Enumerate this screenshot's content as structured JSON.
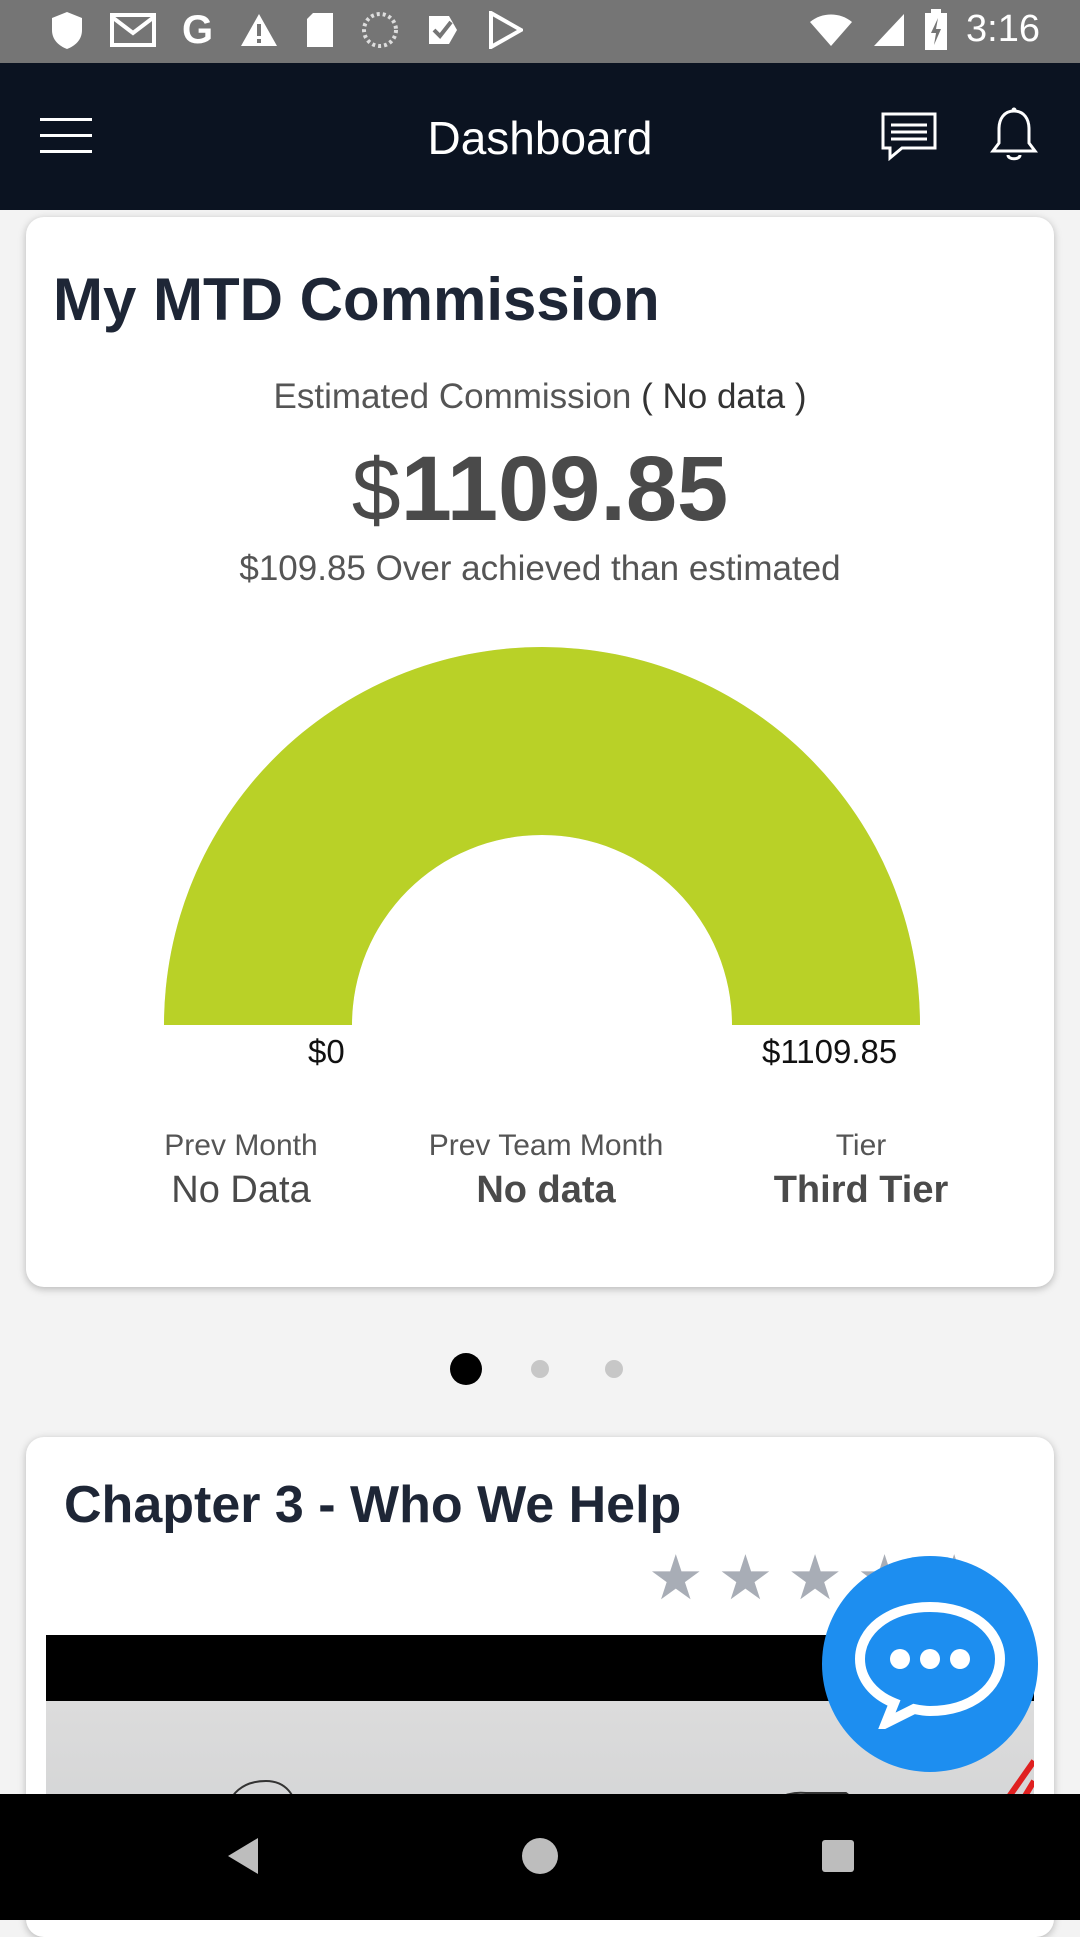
{
  "status_bar": {
    "time": "3:16",
    "icons": [
      "shield-icon",
      "gmail-icon",
      "google-icon",
      "warning-icon",
      "sd-card-icon",
      "loading-icon",
      "task-icon",
      "play-store-icon",
      "wifi-icon",
      "signal-icon",
      "battery-charging-icon"
    ]
  },
  "app_bar": {
    "title": "Dashboard",
    "icons": [
      "menu-icon",
      "message-icon",
      "bell-icon"
    ]
  },
  "commission_card": {
    "title": "My MTD Commission",
    "estimated_label": "Estimated Commission",
    "estimated_value": "( No data )",
    "currency_symbol": "$",
    "amount": "1109.85",
    "over_text": "$109.85 Over achieved than estimated",
    "gauge": {
      "min_label": "$0",
      "max_label": "$1109.85",
      "fill_fraction": 1.0,
      "color": "#b9d127"
    },
    "stats": [
      {
        "label": "Prev Month",
        "value": "No Data"
      },
      {
        "label": "Prev Team Month",
        "value": "No data"
      },
      {
        "label": "Tier",
        "value": "Third Tier"
      }
    ]
  },
  "pager": {
    "count": 3,
    "active_index": 0
  },
  "chapter_card": {
    "title": "Chapter 3 - Who We Help",
    "rating_stars": 5
  },
  "chat_fab": {
    "icon": "chat-bubble-icon",
    "color": "#1d8ef0"
  },
  "nav_bar": {
    "icons": [
      "back-icon",
      "home-icon",
      "recent-apps-icon"
    ]
  }
}
